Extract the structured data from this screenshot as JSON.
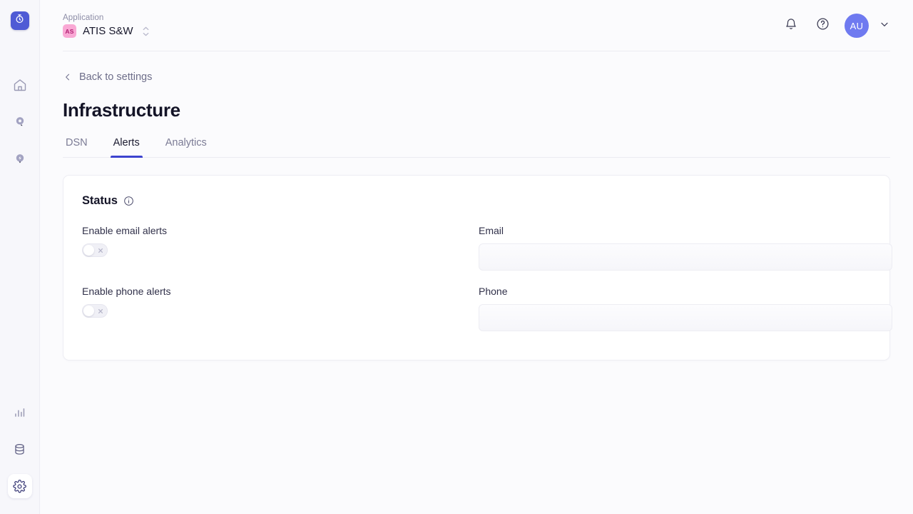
{
  "brand": {
    "logo_icon": "stopwatch-icon",
    "logo_color": "#4f5bd5"
  },
  "rail": {
    "top_items": [
      {
        "name": "home",
        "icon": "home-icon",
        "active": false
      },
      {
        "name": "issues",
        "icon": "bug-pin-icon",
        "active": false
      },
      {
        "name": "performance",
        "icon": "lightning-pin-icon",
        "active": false
      }
    ],
    "bottom_items": [
      {
        "name": "analytics",
        "icon": "bar-chart-icon",
        "active": false
      },
      {
        "name": "database",
        "icon": "database-icon",
        "active": false
      },
      {
        "name": "settings",
        "icon": "gear-icon",
        "active": true
      }
    ]
  },
  "header": {
    "application_label": "Application",
    "application_badge": "AS",
    "application_name": "ATIS S&W",
    "badge_bg": "#f9a8d4",
    "badge_fg": "#b01f72",
    "notifications_icon": "bell-icon",
    "help_icon": "question-circle-icon",
    "avatar_initials": "AU",
    "avatar_color": "#6f7af0",
    "avatar_caret_icon": "chevron-down-icon",
    "stepper_icon": "stepper-updown-icon"
  },
  "page": {
    "back_link": "Back to settings",
    "back_icon": "chevron-left-icon",
    "title": "Infrastructure",
    "tabs": [
      {
        "label": "DSN",
        "active": false
      },
      {
        "label": "Alerts",
        "active": true
      },
      {
        "label": "Analytics",
        "active": false
      }
    ],
    "active_tab_color": "#3c43cf"
  },
  "status_card": {
    "title": "Status",
    "info_icon": "info-circle-icon",
    "fields": [
      {
        "type": "toggle",
        "label": "Enable email alerts",
        "value": "off",
        "mark_icon": "close-x-icon"
      },
      {
        "type": "text",
        "label": "Email",
        "value": "",
        "placeholder": ""
      },
      {
        "type": "toggle",
        "label": "Enable phone alerts",
        "value": "off",
        "mark_icon": "close-x-icon"
      },
      {
        "type": "text",
        "label": "Phone",
        "value": "",
        "placeholder": ""
      }
    ]
  }
}
